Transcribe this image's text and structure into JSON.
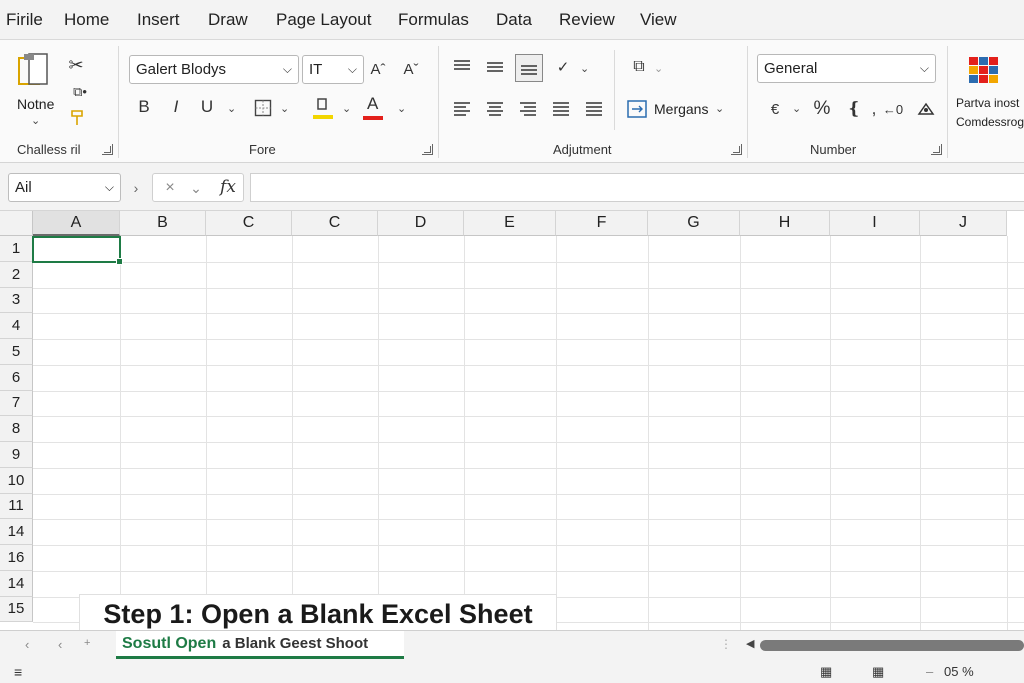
{
  "menu": [
    "Firile",
    "Home",
    "Insert",
    "Draw",
    "Page Layout",
    "Formulas",
    "Data",
    "Review",
    "View"
  ],
  "ribbon": {
    "clipboard": {
      "paste_label": "Notne",
      "group_label": "Challess ril"
    },
    "font": {
      "font_name": "Galert Blodyѕ",
      "font_size": "IT",
      "grow_glyph": "Aˆ",
      "shrink_glyph": "Aˇ",
      "bold": "B",
      "italic": "I",
      "underline": "U",
      "font_color_glyph": "A",
      "group_label": "Fore",
      "fill_color": "#f2d600",
      "font_color": "#e3201b"
    },
    "alignment": {
      "merge_label": "Mergans",
      "group_label": "Adjutment"
    },
    "number": {
      "format": "General",
      "percent": "%",
      "comma": ",",
      "group_label": "Number"
    },
    "styles": {
      "line1": "Partva inost",
      "line2": "Comdessrog"
    }
  },
  "formula_bar": {
    "namebox": "Ail",
    "fx": "fx"
  },
  "grid": {
    "columns": [
      "A",
      "B",
      "C",
      "C",
      "D",
      "E",
      "F",
      "G",
      "H",
      "I",
      "J"
    ],
    "rows": [
      "1",
      "2",
      "3",
      "4",
      "5",
      "6",
      "7",
      "8",
      "9",
      "10",
      "11",
      "14",
      "16",
      "14",
      "15"
    ]
  },
  "caption": "Step 1: Open a Blank Excel Sheet",
  "sheet_tab": {
    "part1": "Sosutl Open",
    "part2": "a Blank Geest Shoot"
  },
  "status": {
    "zoom": "05 %"
  },
  "colors": {
    "accent": "#1e7b45"
  }
}
